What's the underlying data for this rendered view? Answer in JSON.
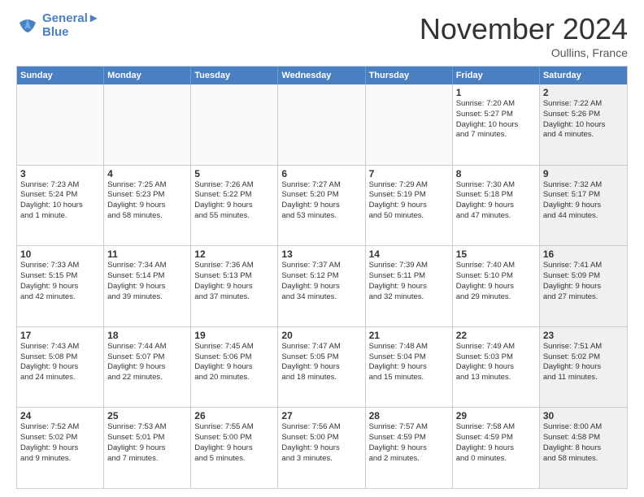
{
  "logo": {
    "line1": "General",
    "line2": "Blue"
  },
  "title": "November 2024",
  "location": "Oullins, France",
  "weekdays": [
    "Sunday",
    "Monday",
    "Tuesday",
    "Wednesday",
    "Thursday",
    "Friday",
    "Saturday"
  ],
  "rows": [
    [
      {
        "day": "",
        "info": "",
        "empty": true
      },
      {
        "day": "",
        "info": "",
        "empty": true
      },
      {
        "day": "",
        "info": "",
        "empty": true
      },
      {
        "day": "",
        "info": "",
        "empty": true
      },
      {
        "day": "",
        "info": "",
        "empty": true
      },
      {
        "day": "1",
        "info": "Sunrise: 7:20 AM\nSunset: 5:27 PM\nDaylight: 10 hours\nand 7 minutes.",
        "empty": false
      },
      {
        "day": "2",
        "info": "Sunrise: 7:22 AM\nSunset: 5:26 PM\nDaylight: 10 hours\nand 4 minutes.",
        "empty": false,
        "shaded": true
      }
    ],
    [
      {
        "day": "3",
        "info": "Sunrise: 7:23 AM\nSunset: 5:24 PM\nDaylight: 10 hours\nand 1 minute.",
        "empty": false
      },
      {
        "day": "4",
        "info": "Sunrise: 7:25 AM\nSunset: 5:23 PM\nDaylight: 9 hours\nand 58 minutes.",
        "empty": false
      },
      {
        "day": "5",
        "info": "Sunrise: 7:26 AM\nSunset: 5:22 PM\nDaylight: 9 hours\nand 55 minutes.",
        "empty": false
      },
      {
        "day": "6",
        "info": "Sunrise: 7:27 AM\nSunset: 5:20 PM\nDaylight: 9 hours\nand 53 minutes.",
        "empty": false
      },
      {
        "day": "7",
        "info": "Sunrise: 7:29 AM\nSunset: 5:19 PM\nDaylight: 9 hours\nand 50 minutes.",
        "empty": false
      },
      {
        "day": "8",
        "info": "Sunrise: 7:30 AM\nSunset: 5:18 PM\nDaylight: 9 hours\nand 47 minutes.",
        "empty": false
      },
      {
        "day": "9",
        "info": "Sunrise: 7:32 AM\nSunset: 5:17 PM\nDaylight: 9 hours\nand 44 minutes.",
        "empty": false,
        "shaded": true
      }
    ],
    [
      {
        "day": "10",
        "info": "Sunrise: 7:33 AM\nSunset: 5:15 PM\nDaylight: 9 hours\nand 42 minutes.",
        "empty": false
      },
      {
        "day": "11",
        "info": "Sunrise: 7:34 AM\nSunset: 5:14 PM\nDaylight: 9 hours\nand 39 minutes.",
        "empty": false
      },
      {
        "day": "12",
        "info": "Sunrise: 7:36 AM\nSunset: 5:13 PM\nDaylight: 9 hours\nand 37 minutes.",
        "empty": false
      },
      {
        "day": "13",
        "info": "Sunrise: 7:37 AM\nSunset: 5:12 PM\nDaylight: 9 hours\nand 34 minutes.",
        "empty": false
      },
      {
        "day": "14",
        "info": "Sunrise: 7:39 AM\nSunset: 5:11 PM\nDaylight: 9 hours\nand 32 minutes.",
        "empty": false
      },
      {
        "day": "15",
        "info": "Sunrise: 7:40 AM\nSunset: 5:10 PM\nDaylight: 9 hours\nand 29 minutes.",
        "empty": false
      },
      {
        "day": "16",
        "info": "Sunrise: 7:41 AM\nSunset: 5:09 PM\nDaylight: 9 hours\nand 27 minutes.",
        "empty": false,
        "shaded": true
      }
    ],
    [
      {
        "day": "17",
        "info": "Sunrise: 7:43 AM\nSunset: 5:08 PM\nDaylight: 9 hours\nand 24 minutes.",
        "empty": false
      },
      {
        "day": "18",
        "info": "Sunrise: 7:44 AM\nSunset: 5:07 PM\nDaylight: 9 hours\nand 22 minutes.",
        "empty": false
      },
      {
        "day": "19",
        "info": "Sunrise: 7:45 AM\nSunset: 5:06 PM\nDaylight: 9 hours\nand 20 minutes.",
        "empty": false
      },
      {
        "day": "20",
        "info": "Sunrise: 7:47 AM\nSunset: 5:05 PM\nDaylight: 9 hours\nand 18 minutes.",
        "empty": false
      },
      {
        "day": "21",
        "info": "Sunrise: 7:48 AM\nSunset: 5:04 PM\nDaylight: 9 hours\nand 15 minutes.",
        "empty": false
      },
      {
        "day": "22",
        "info": "Sunrise: 7:49 AM\nSunset: 5:03 PM\nDaylight: 9 hours\nand 13 minutes.",
        "empty": false
      },
      {
        "day": "23",
        "info": "Sunrise: 7:51 AM\nSunset: 5:02 PM\nDaylight: 9 hours\nand 11 minutes.",
        "empty": false,
        "shaded": true
      }
    ],
    [
      {
        "day": "24",
        "info": "Sunrise: 7:52 AM\nSunset: 5:02 PM\nDaylight: 9 hours\nand 9 minutes.",
        "empty": false
      },
      {
        "day": "25",
        "info": "Sunrise: 7:53 AM\nSunset: 5:01 PM\nDaylight: 9 hours\nand 7 minutes.",
        "empty": false
      },
      {
        "day": "26",
        "info": "Sunrise: 7:55 AM\nSunset: 5:00 PM\nDaylight: 9 hours\nand 5 minutes.",
        "empty": false
      },
      {
        "day": "27",
        "info": "Sunrise: 7:56 AM\nSunset: 5:00 PM\nDaylight: 9 hours\nand 3 minutes.",
        "empty": false
      },
      {
        "day": "28",
        "info": "Sunrise: 7:57 AM\nSunset: 4:59 PM\nDaylight: 9 hours\nand 2 minutes.",
        "empty": false
      },
      {
        "day": "29",
        "info": "Sunrise: 7:58 AM\nSunset: 4:59 PM\nDaylight: 9 hours\nand 0 minutes.",
        "empty": false
      },
      {
        "day": "30",
        "info": "Sunrise: 8:00 AM\nSunset: 4:58 PM\nDaylight: 8 hours\nand 58 minutes.",
        "empty": false,
        "shaded": true
      }
    ]
  ]
}
